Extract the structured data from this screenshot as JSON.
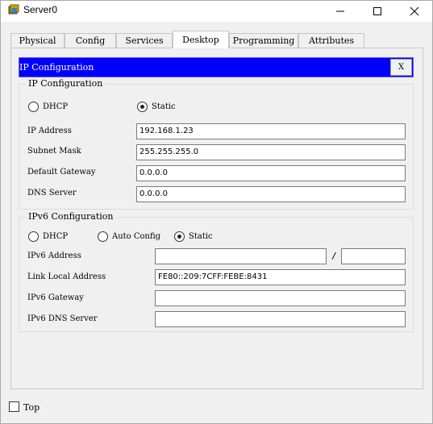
{
  "window": {
    "title": "Server0"
  },
  "tabs": [
    {
      "label": "Physical"
    },
    {
      "label": "Config"
    },
    {
      "label": "Services"
    },
    {
      "label": "Desktop"
    },
    {
      "label": "Programming"
    },
    {
      "label": "Attributes"
    }
  ],
  "active_tab": "Desktop",
  "ip_config_window": {
    "title": "IP Configuration",
    "close_label": "X"
  },
  "ipv4": {
    "group_title": "IP Configuration",
    "dhcp_label": "DHCP",
    "static_label": "Static",
    "mode": "Static",
    "ip_address_label": "IP Address",
    "ip_address_value": "192.168.1.23",
    "subnet_mask_label": "Subnet Mask",
    "subnet_mask_value": "255.255.255.0",
    "default_gateway_label": "Default Gateway",
    "default_gateway_value": "0.0.0.0",
    "dns_server_label": "DNS Server",
    "dns_server_value": "0.0.0.0"
  },
  "ipv6": {
    "group_title": "IPv6 Configuration",
    "dhcp_label": "DHCP",
    "auto_config_label": "Auto Config",
    "static_label": "Static",
    "mode": "Static",
    "address_label": "IPv6 Address",
    "address_value": "",
    "prefix_separator": "/",
    "prefix_value": "",
    "link_local_label": "Link Local Address",
    "link_local_value": "FE80::209:7CFF:FEBE:8431",
    "gateway_label": "IPv6 Gateway",
    "gateway_value": "",
    "dns_server_label": "IPv6 DNS Server",
    "dns_server_value": ""
  },
  "footer": {
    "top_label": "Top",
    "top_checked": false
  }
}
